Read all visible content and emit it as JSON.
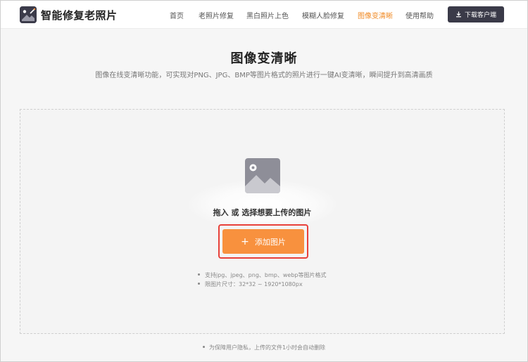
{
  "brand": {
    "name": "智能修复老照片",
    "logo_icon": "photo-restore-logo-icon",
    "logo_color": "#3b3b4a"
  },
  "nav": {
    "items": [
      {
        "label": "首页",
        "active": false
      },
      {
        "label": "老照片修复",
        "active": false
      },
      {
        "label": "黑白照片上色",
        "active": false
      },
      {
        "label": "模糊人脸修复",
        "active": false
      },
      {
        "label": "图像变清晰",
        "active": true
      },
      {
        "label": "使用帮助",
        "active": false
      }
    ],
    "active_color": "#f08a24"
  },
  "download": {
    "label": "下载客户端",
    "icon": "download-icon",
    "bg_color": "#3a3a48"
  },
  "main": {
    "title": "图像变清晰",
    "subtitle": "图像在线变清晰功能，可实现对PNG、JPG、BMP等图片格式的照片进行一键AI变清晰，瞬间提升到高清画质"
  },
  "upload": {
    "icon": "image-placeholder-icon",
    "prompt": "拖入 或 选择想要上传的图片",
    "add_button_label": "添加图片",
    "add_button_icon": "plus-icon",
    "add_button_color": "#f8913e",
    "highlight_color": "#e8413a",
    "hints": [
      "支持jpg、jpeg、png、bmp、webp等图片格式",
      "限图片尺寸：32*32 ~ 1920*1080px"
    ]
  },
  "footer": {
    "privacy": "为保障用户隐私，上传的文件1小时会自动删除"
  }
}
